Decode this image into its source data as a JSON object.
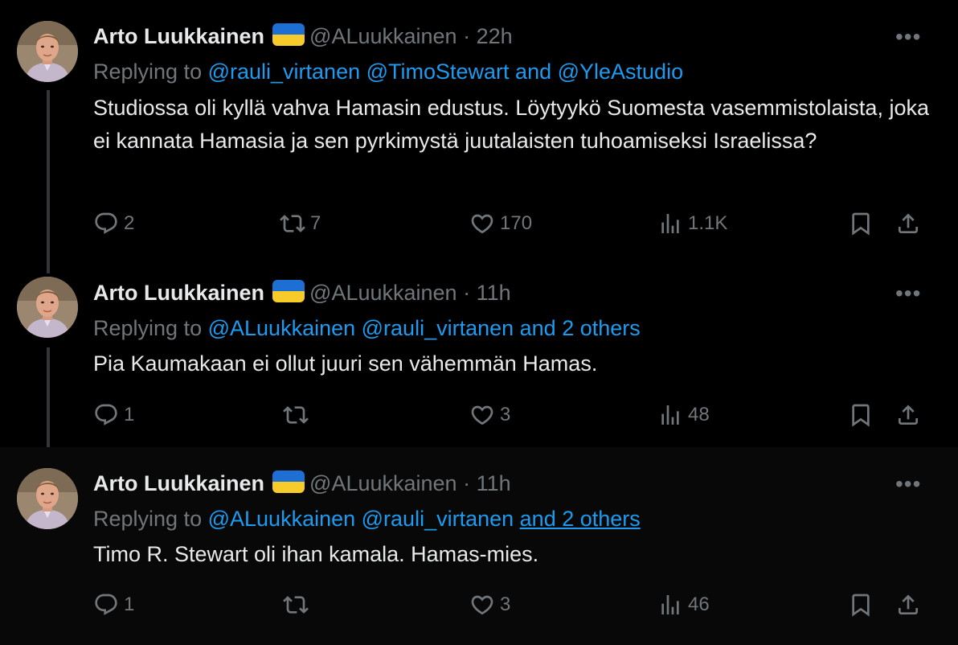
{
  "tweets": [
    {
      "name": "Arto Luukkainen",
      "handle": "@ALuukkainen",
      "dot": "·",
      "time": "22h",
      "replying_prefix": "Replying to",
      "replying_links": "@rauli_virtanen @TimoStewart and @YleAstudio",
      "replying_links_underlined": "",
      "text": "Studiossa oli kyllä vahva Hamasin edustus. Löytyykö Suomesta vasemmistolaista, joka ei kannata Hamasia ja sen pyrkimystä juutalaisten tuhoamiseksi Israelissa?",
      "replies": "2",
      "retweets": "7",
      "likes": "170",
      "views": "1.1K"
    },
    {
      "name": "Arto Luukkainen",
      "handle": "@ALuukkainen",
      "dot": "·",
      "time": "11h",
      "replying_prefix": "Replying to",
      "replying_links": "@ALuukkainen @rauli_virtanen and 2 others",
      "replying_links_underlined": "",
      "text": "Pia Kaumakaan ei ollut juuri sen vähemmän Hamas.",
      "replies": "1",
      "retweets": "",
      "likes": "3",
      "views": "48"
    },
    {
      "name": "Arto Luukkainen",
      "handle": "@ALuukkainen",
      "dot": "·",
      "time": "11h",
      "replying_prefix": "Replying to",
      "replying_links": "@ALuukkainen @rauli_virtanen",
      "replying_links_underlined": "and 2 others",
      "text": "Timo R. Stewart oli ihan kamala. Hamas-mies.",
      "replies": "1",
      "retweets": "",
      "likes": "3",
      "views": "46"
    }
  ],
  "icons": {
    "more": "more-icon",
    "flag": "ukraine-flag-icon",
    "reply": "reply-icon",
    "retweet": "retweet-icon",
    "like": "heart-icon",
    "views": "views-icon",
    "bookmark": "bookmark-icon",
    "share": "share-icon"
  },
  "colors": {
    "background": "#000000",
    "highlight_background": "#080808",
    "text": "#e7e9ea",
    "muted": "#71767b",
    "link": "#1d9bf0",
    "flag_blue": "#1d6fd4",
    "flag_yellow": "#f7cc2a"
  }
}
